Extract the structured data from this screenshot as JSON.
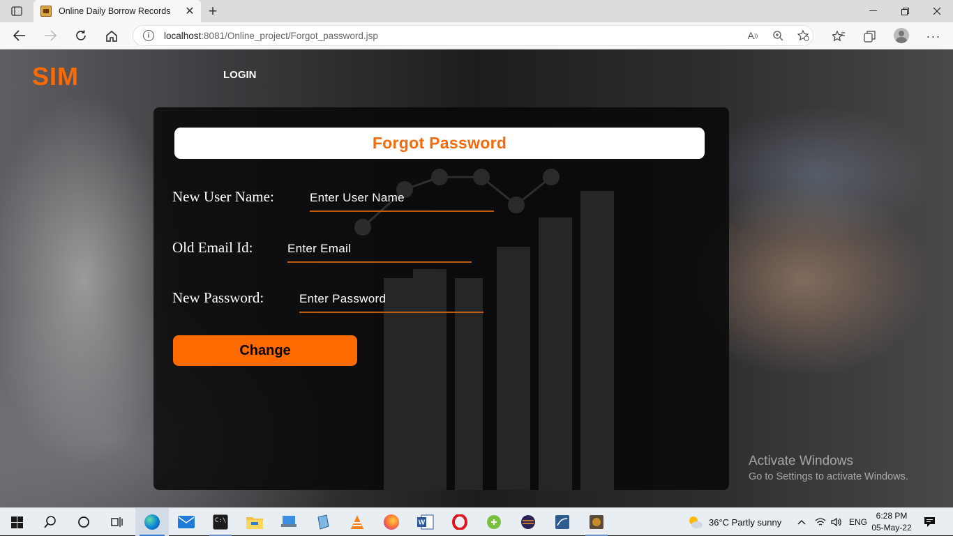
{
  "browser": {
    "tab_title": "Online Daily Borrow Records",
    "url_host": "localhost",
    "url_rest": ":8081/Online_project/Forgot_password.jsp"
  },
  "site": {
    "logo": "SIM",
    "nav_login": "LOGIN"
  },
  "form": {
    "heading": "Forgot Password",
    "username_label": "New User Name:",
    "username_placeholder": "Enter User Name",
    "email_label": "Old Email Id:",
    "email_placeholder": "Enter Email",
    "password_label": "New Password:",
    "password_placeholder": "Enter Password",
    "submit_label": "Change"
  },
  "watermark": {
    "line1": "Activate Windows",
    "line2": "Go to Settings to activate Windows."
  },
  "taskbar": {
    "weather": "36°C  Partly sunny",
    "language": "ENG",
    "time": "6:28 PM",
    "date": "05-May-22"
  },
  "colors": {
    "accent": "#ff6a00",
    "heading_text": "#f26b0c"
  }
}
